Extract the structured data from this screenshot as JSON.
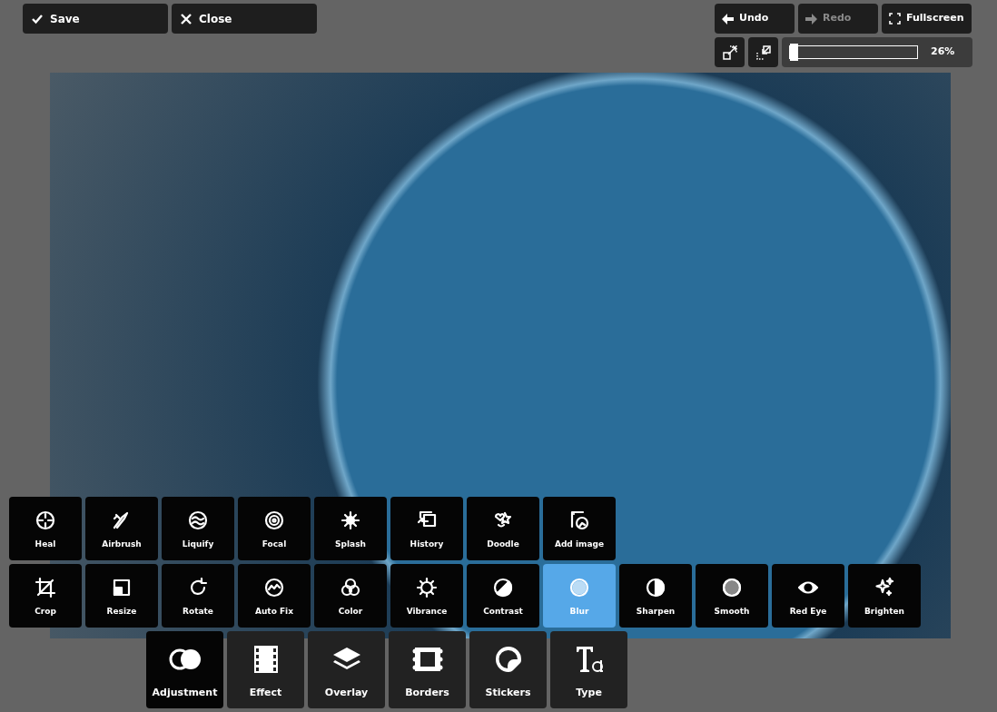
{
  "top_left_buttons": [
    {
      "label": "Save",
      "kind": "save"
    },
    {
      "label": "Close",
      "kind": "close"
    }
  ],
  "history_buttons": [
    {
      "label": "Undo",
      "kind": "undo",
      "disabled": false
    },
    {
      "label": "Redo",
      "kind": "redo",
      "disabled": true
    },
    {
      "label": "Fullscreen",
      "kind": "fullscreen",
      "disabled": false
    }
  ],
  "zoom": {
    "level": 0,
    "reading": "26%"
  },
  "tools": [
    {
      "label": "Heal",
      "selected": false
    },
    {
      "label": "Airbrush",
      "selected": false
    },
    {
      "label": "Liquify",
      "selected": false
    },
    {
      "label": "Focal",
      "selected": false
    },
    {
      "label": "Splash",
      "selected": false
    },
    {
      "label": "History",
      "selected": false
    },
    {
      "label": "Doodle",
      "selected": false
    },
    {
      "label": "Add image",
      "selected": false
    }
  ],
  "tools_row_2": [
    {
      "label": "Crop",
      "selected": false
    },
    {
      "label": "Resize",
      "selected": false
    },
    {
      "label": "Rotate",
      "selected": false
    },
    {
      "label": "Auto Fix",
      "selected": false
    },
    {
      "label": "Color",
      "selected": false
    },
    {
      "label": "Vibrance",
      "selected": false
    },
    {
      "label": "Contrast",
      "selected": false
    },
    {
      "label": "Blur",
      "selected": true
    },
    {
      "label": "Sharpen",
      "selected": false
    },
    {
      "label": "Smooth",
      "selected": false
    },
    {
      "label": "Red Eye",
      "selected": false
    },
    {
      "label": "Brighten",
      "selected": false
    }
  ],
  "category_tabs": [
    {
      "label": "Adjustment",
      "selected": true
    },
    {
      "label": "Effect",
      "selected": false
    },
    {
      "label": "Overlay",
      "selected": false
    },
    {
      "label": "Borders",
      "selected": false
    },
    {
      "label": "Stickers",
      "selected": false
    },
    {
      "label": "Type",
      "selected": false
    }
  ]
}
